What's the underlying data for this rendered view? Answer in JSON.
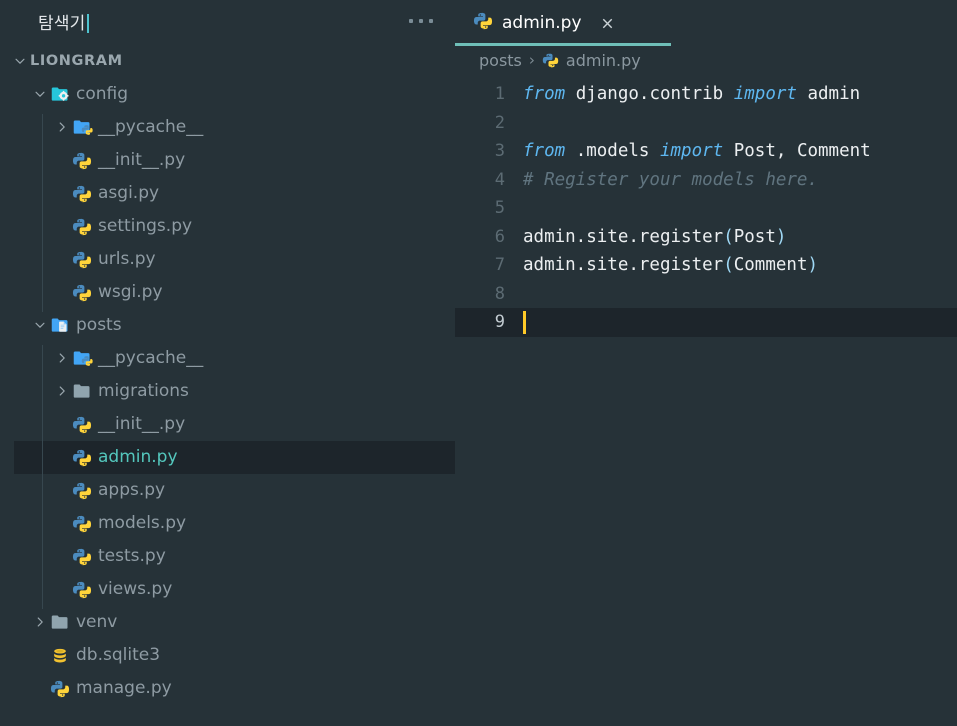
{
  "sidebar": {
    "title": "탐색기",
    "more_actions_icon": "ellipsis-icon",
    "root": {
      "label": "LIONGRAM",
      "expanded": true
    },
    "items": [
      {
        "label": "config",
        "icon": "folder-config-icon",
        "type": "folder",
        "depth": 1,
        "expanded": true,
        "twisty": "chevron-down"
      },
      {
        "label": "__pycache__",
        "icon": "folder-python-icon",
        "type": "folder",
        "depth": 2,
        "expanded": false,
        "twisty": "chevron-right"
      },
      {
        "label": "__init__.py",
        "icon": "python-file-icon",
        "type": "file",
        "depth": 2
      },
      {
        "label": "asgi.py",
        "icon": "python-file-icon",
        "type": "file",
        "depth": 2
      },
      {
        "label": "settings.py",
        "icon": "python-file-icon",
        "type": "file",
        "depth": 2
      },
      {
        "label": "urls.py",
        "icon": "python-file-icon",
        "type": "file",
        "depth": 2
      },
      {
        "label": "wsgi.py",
        "icon": "python-file-icon",
        "type": "file",
        "depth": 2
      },
      {
        "label": "posts",
        "icon": "folder-app-icon",
        "type": "folder",
        "depth": 1,
        "expanded": true,
        "twisty": "chevron-down"
      },
      {
        "label": "__pycache__",
        "icon": "folder-python-icon",
        "type": "folder",
        "depth": 2,
        "expanded": false,
        "twisty": "chevron-right"
      },
      {
        "label": "migrations",
        "icon": "folder-icon",
        "type": "folder",
        "depth": 2,
        "expanded": false,
        "twisty": "chevron-right"
      },
      {
        "label": "__init__.py",
        "icon": "python-file-icon",
        "type": "file",
        "depth": 2
      },
      {
        "label": "admin.py",
        "icon": "python-file-icon",
        "type": "file",
        "depth": 2,
        "selected": true
      },
      {
        "label": "apps.py",
        "icon": "python-file-icon",
        "type": "file",
        "depth": 2
      },
      {
        "label": "models.py",
        "icon": "python-file-icon",
        "type": "file",
        "depth": 2
      },
      {
        "label": "tests.py",
        "icon": "python-file-icon",
        "type": "file",
        "depth": 2
      },
      {
        "label": "views.py",
        "icon": "python-file-icon",
        "type": "file",
        "depth": 2
      },
      {
        "label": "venv",
        "icon": "folder-icon",
        "type": "folder",
        "depth": 1,
        "expanded": false,
        "twisty": "chevron-right"
      },
      {
        "label": "db.sqlite3",
        "icon": "database-icon",
        "type": "file",
        "depth": 1
      },
      {
        "label": "manage.py",
        "icon": "python-file-icon",
        "type": "file",
        "depth": 1
      }
    ]
  },
  "editor": {
    "tab": {
      "label": "admin.py",
      "icon": "python-file-icon",
      "close_icon": "close-icon",
      "active": true
    },
    "breadcrumb": [
      {
        "label": "posts",
        "icon": ""
      },
      {
        "label": "admin.py",
        "icon": "python-file-icon"
      }
    ],
    "breadcrumb_separator": "›",
    "active_line": 9,
    "cursor_column": 1,
    "lines": [
      {
        "n": "1",
        "tokens": [
          {
            "t": "from",
            "c": "kw"
          },
          {
            "t": " django.contrib ",
            "c": ""
          },
          {
            "t": "import",
            "c": "kw"
          },
          {
            "t": " admin",
            "c": ""
          }
        ]
      },
      {
        "n": "2",
        "tokens": []
      },
      {
        "n": "3",
        "tokens": [
          {
            "t": "from",
            "c": "kw"
          },
          {
            "t": " .models ",
            "c": ""
          },
          {
            "t": "import",
            "c": "kw"
          },
          {
            "t": " Post, Comment",
            "c": ""
          }
        ]
      },
      {
        "n": "4",
        "tokens": [
          {
            "t": "# Register your models here.",
            "c": "cm"
          }
        ]
      },
      {
        "n": "5",
        "tokens": []
      },
      {
        "n": "6",
        "tokens": [
          {
            "t": "admin.site.register",
            "c": ""
          },
          {
            "t": "(",
            "c": "pn"
          },
          {
            "t": "Post",
            "c": ""
          },
          {
            "t": ")",
            "c": "pn"
          }
        ]
      },
      {
        "n": "7",
        "tokens": [
          {
            "t": "admin.site.register",
            "c": ""
          },
          {
            "t": "(",
            "c": "pn"
          },
          {
            "t": "Comment",
            "c": ""
          },
          {
            "t": ")",
            "c": "pn"
          }
        ]
      },
      {
        "n": "8",
        "tokens": []
      },
      {
        "n": "9",
        "tokens": [],
        "active": true,
        "cursor": true
      }
    ]
  },
  "colors": {
    "editor_bg": "#263238",
    "sidebar_bg": "#263238",
    "active_line_bg": "#1d252b",
    "selection_bg": "#1d252b",
    "selection_text": "#54c7bd",
    "tab_accent": "#6fbfb8",
    "keyword": "#5eb7f0",
    "comment": "#60747f",
    "paren": "#9fd8f5",
    "cursor": "#ffca28",
    "foreground": "#eceff1",
    "tree_text": "#8e9ba3"
  }
}
